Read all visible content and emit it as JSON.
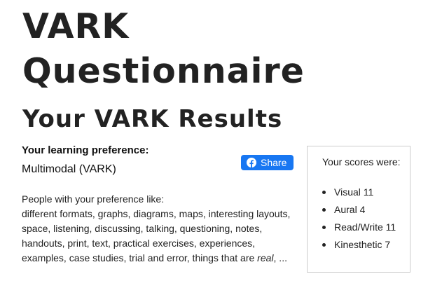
{
  "header": {
    "title_line1": "VARK",
    "title_line2": "Questionnaire",
    "subtitle": "Your VARK Results"
  },
  "preference": {
    "label": "Your learning preference:",
    "value": "Multimodal (VARK)"
  },
  "share": {
    "label": "Share",
    "icon": "facebook-icon",
    "color": "#1877f2"
  },
  "description": {
    "intro": "People with your preference like:",
    "text_main": "different formats, graphs, diagrams, maps, interesting layouts, space, listening, discussing, talking, questioning, notes, handouts, print, text, practical exercises, experiences, examples, case studies, trial and error, things that are ",
    "text_em": "real",
    "text_end": ", ..."
  },
  "scores": {
    "title": "Your scores were:",
    "items": [
      {
        "label": "Visual 11"
      },
      {
        "label": "Aural 4"
      },
      {
        "label": "Read/Write 11"
      },
      {
        "label": "Kinesthetic 7"
      }
    ]
  }
}
